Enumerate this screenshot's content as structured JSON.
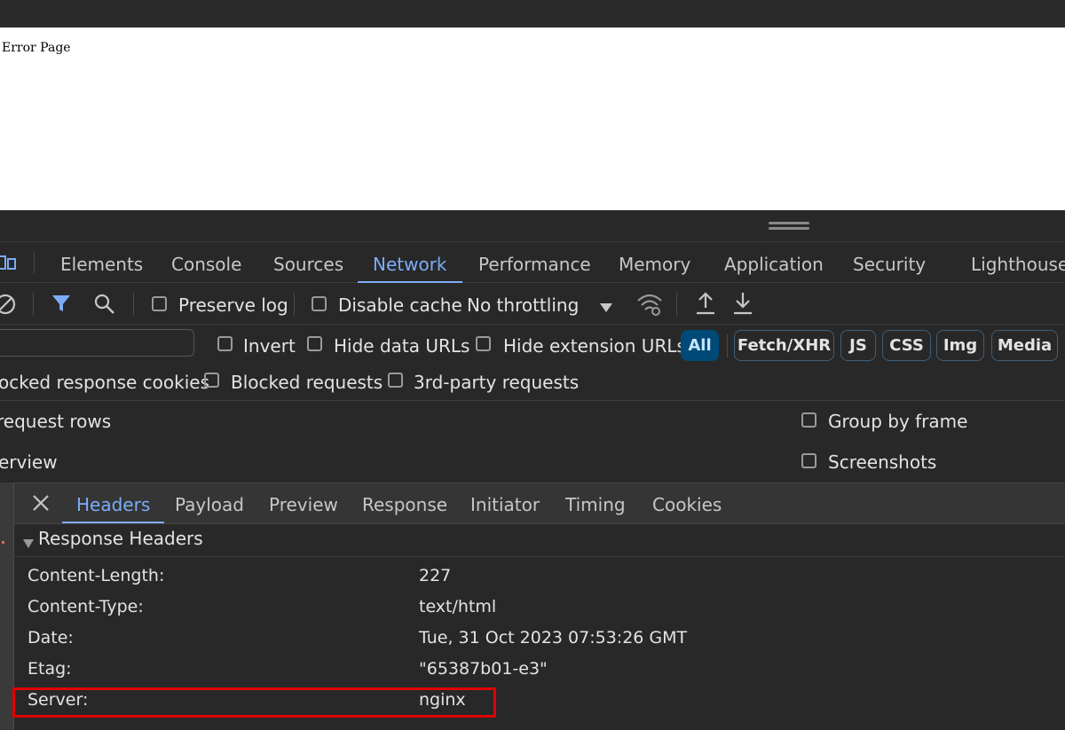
{
  "page": {
    "text": "Error Page"
  },
  "devtools": {
    "tabs": [
      "Elements",
      "Console",
      "Sources",
      "Network",
      "Performance",
      "Memory",
      "Application",
      "Security",
      "Lighthouse"
    ],
    "active_tab": "Network",
    "toolbar": {
      "preserve_log": "Preserve log",
      "disable_cache": "Disable cache",
      "throttling": "No throttling"
    },
    "filter": {
      "invert": "Invert",
      "hide_data_urls": "Hide data URLs",
      "hide_extension_urls": "Hide extension URLs",
      "types": [
        "All",
        "Fetch/XHR",
        "JS",
        "CSS",
        "Img",
        "Media"
      ],
      "active_type": "All"
    },
    "row3": {
      "blocked_cookies": "ocked response cookies",
      "blocked_requests": "Blocked requests",
      "third_party": "3rd-party requests"
    },
    "options": {
      "request_rows": "request rows",
      "overview": "erview",
      "group_by_frame": "Group by frame",
      "screenshots": "Screenshots"
    },
    "detail_tabs": [
      "Headers",
      "Payload",
      "Preview",
      "Response",
      "Initiator",
      "Timing",
      "Cookies"
    ],
    "active_detail_tab": "Headers",
    "section_title": "Response Headers",
    "headers": [
      {
        "name": "Content-Length:",
        "value": "227"
      },
      {
        "name": "Content-Type:",
        "value": "text/html"
      },
      {
        "name": "Date:",
        "value": "Tue, 31 Oct 2023 07:53:26 GMT"
      },
      {
        "name": "Etag:",
        "value": "\"65387b01-e3\""
      },
      {
        "name": "Server:",
        "value": "nginx"
      }
    ],
    "highlight_color": "#e00000",
    "accent_color": "#7cacf8"
  }
}
